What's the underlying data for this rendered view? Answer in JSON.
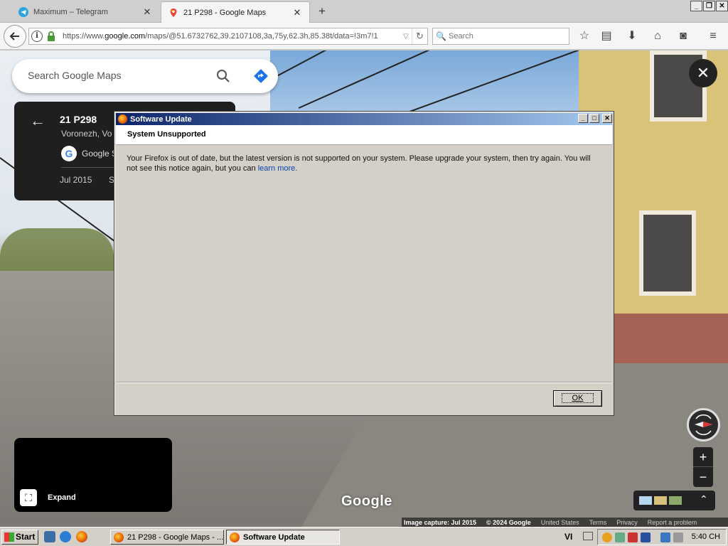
{
  "browser": {
    "tabs": [
      {
        "title": "Maximum – Telegram",
        "active": false,
        "icon": "telegram-icon"
      },
      {
        "title": "21 P298 - Google Maps",
        "active": true,
        "icon": "google-maps-pin-icon"
      }
    ],
    "new_tab": "+",
    "window_controls": [
      "_",
      "🗗",
      "✕"
    ],
    "url_prefix": "https://www.",
    "url_domain": "google.com",
    "url_path": "/maps/@51.6732762,39.2107108,3a,75y,62.3h,85.38t/data=!3m7!1",
    "search_placeholder": "Search"
  },
  "maps": {
    "search_placeholder": "Search Google Maps",
    "place_title": "21 P298",
    "place_subtitle": "Voronezh, Vo",
    "provider_label": "Google S",
    "capture_date": "Jul 2015",
    "capture_date_extra": "S",
    "expand_label": "Expand",
    "watermark": "Google",
    "attribution": {
      "capture": "Image capture: Jul 2015",
      "copyright": "© 2024 Google",
      "country": "United States",
      "terms": "Terms",
      "privacy": "Privacy",
      "report": "Report a problem"
    }
  },
  "dialog": {
    "title": "Software Update",
    "heading": "System Unsupported",
    "message": "Your Firefox is out of date, but the latest version is not supported on your system. Please upgrade your system, then try again. You will not see this notice again, but you can ",
    "link_text": "learn more.",
    "ok_label": "OK"
  },
  "taskbar": {
    "start_label": "Start",
    "tasks": [
      {
        "label": "21 P298 - Google Maps - ...",
        "active": false
      },
      {
        "label": "Software Update",
        "active": true
      }
    ],
    "language": "VI",
    "clock": "5:40 CH"
  },
  "colors": {
    "dialog_title_start": "#0a246a",
    "dialog_title_end": "#a6caf0",
    "link": "#0645ad",
    "telegram": "#2aa3df",
    "maps_blue": "#4285f4"
  }
}
